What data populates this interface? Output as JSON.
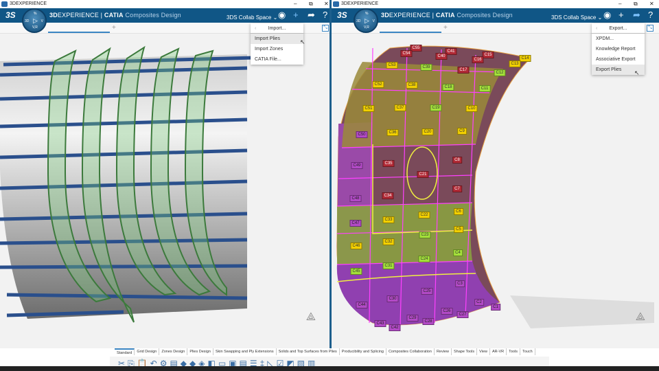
{
  "window": {
    "title": "3DEXPERIENCE",
    "minimize": "–",
    "restore": "⧉",
    "close": "✕"
  },
  "app": {
    "brand_bold": "3D",
    "brand": "EXPERIENCE | ",
    "catia": "CATIA",
    "module": " Composites Design",
    "collab_space": "3DS Collab Space ⌄",
    "compass_top": "%",
    "compass_left": "3D",
    "compass_right": "V",
    "compass_bottom": "V,R",
    "compass_play": "▷"
  },
  "icons": {
    "user": "user-icon",
    "add": "plus-icon",
    "share": "share-icon",
    "help": "help-icon"
  },
  "left_menu": {
    "header": "Import...",
    "items": [
      "Import Plies",
      "Import Zones",
      "CATIA File..."
    ],
    "highlighted": 0
  },
  "right_menu": {
    "header": "Export...",
    "items": [
      "XPDM...",
      "Knowledge Report",
      "Associative Export",
      "Export Plies"
    ],
    "highlighted": 3
  },
  "plies": [
    {
      "label": "C55",
      "color": "red"
    },
    {
      "label": "C54",
      "color": "red"
    },
    {
      "label": "C41",
      "color": "red"
    },
    {
      "label": "C40",
      "color": "red"
    },
    {
      "label": "C15",
      "color": "red"
    },
    {
      "label": "C16",
      "color": "red"
    },
    {
      "label": "C14",
      "color": "yellow"
    },
    {
      "label": "C13",
      "color": "yellow"
    },
    {
      "label": "C53",
      "color": "yellow"
    },
    {
      "label": "C39",
      "color": "green"
    },
    {
      "label": "C17",
      "color": "red"
    },
    {
      "label": "C12",
      "color": "green"
    },
    {
      "label": "C52",
      "color": "yellow"
    },
    {
      "label": "C38",
      "color": "yellow"
    },
    {
      "label": "C18",
      "color": "green"
    },
    {
      "label": "C11",
      "color": "green"
    },
    {
      "label": "C51",
      "color": "yellow"
    },
    {
      "label": "C37",
      "color": "yellow"
    },
    {
      "label": "C19",
      "color": "green"
    },
    {
      "label": "C10",
      "color": "yellow"
    },
    {
      "label": "C50",
      "color": "purple"
    },
    {
      "label": "C36",
      "color": "yellow"
    },
    {
      "label": "C20",
      "color": "yellow"
    },
    {
      "label": "C9",
      "color": "yellow"
    },
    {
      "label": "C49",
      "color": "purple"
    },
    {
      "label": "C35",
      "color": "red"
    },
    {
      "label": "C21",
      "color": "red"
    },
    {
      "label": "C8",
      "color": "red"
    },
    {
      "label": "C48",
      "color": "purple"
    },
    {
      "label": "C34",
      "color": "red"
    },
    {
      "label": "C7",
      "color": "red"
    },
    {
      "label": "C47",
      "color": "purple"
    },
    {
      "label": "C33",
      "color": "yellow"
    },
    {
      "label": "C22",
      "color": "yellow"
    },
    {
      "label": "C6",
      "color": "yellow"
    },
    {
      "label": "C46",
      "color": "yellow"
    },
    {
      "label": "C32",
      "color": "yellow"
    },
    {
      "label": "C23",
      "color": "green"
    },
    {
      "label": "C5",
      "color": "yellow"
    },
    {
      "label": "C45",
      "color": "green"
    },
    {
      "label": "C31",
      "color": "green"
    },
    {
      "label": "C24",
      "color": "green"
    },
    {
      "label": "C4",
      "color": "green"
    },
    {
      "label": "C44",
      "color": "purple"
    },
    {
      "label": "C30",
      "color": "purple"
    },
    {
      "label": "C25",
      "color": "purple"
    },
    {
      "label": "C3",
      "color": "purple"
    },
    {
      "label": "C2",
      "color": "purple"
    },
    {
      "label": "C1",
      "color": "purple"
    },
    {
      "label": "C26",
      "color": "purple"
    },
    {
      "label": "C27",
      "color": "purple"
    },
    {
      "label": "C29",
      "color": "purple"
    },
    {
      "label": "C28",
      "color": "purple"
    },
    {
      "label": "C43",
      "color": "purple"
    },
    {
      "label": "C42",
      "color": "purple"
    }
  ],
  "workbench_tabs": [
    "Standard",
    "Grid Design",
    "Zones Design",
    "Plies Design",
    "Skin Swapping and Ply Extensions",
    "Solids and Top Surfaces from Plies",
    "Producibility and Splicing",
    "Composites Collaboration",
    "Review",
    "Shape Tools",
    "View",
    "AR-VR",
    "Tools",
    "Touch"
  ],
  "toolbar_icons": [
    "✂",
    "⎘",
    "📋",
    "↶",
    "⚙",
    "▤",
    "◆",
    "◆",
    "◈",
    "◧",
    "▭",
    "▣",
    "▤",
    "☰",
    "‡",
    "◺",
    "☑",
    "◩",
    "▧",
    "▥"
  ]
}
